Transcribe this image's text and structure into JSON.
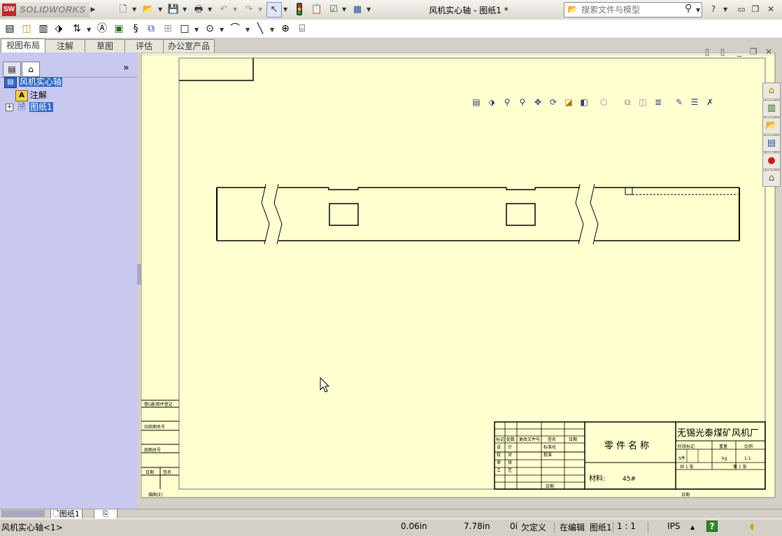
{
  "app": {
    "name": "SOLIDWORKS",
    "logo_mark": "SW",
    "document_title": "风机实心轴 - 图纸1 *"
  },
  "search": {
    "placeholder": "搜索文件与模型"
  },
  "title_controls": {
    "help": "?",
    "minimize": "▭",
    "restore": "❐",
    "close": "✕"
  },
  "command_tabs": [
    {
      "label": "视图布局",
      "active": true
    },
    {
      "label": "注解",
      "active": false
    },
    {
      "label": "草图",
      "active": false
    },
    {
      "label": "评估",
      "active": false
    },
    {
      "label": "办公室产品",
      "active": false
    }
  ],
  "feature_tree": {
    "root": "风机实心轴",
    "items": [
      {
        "label": "注解",
        "icon": "annotation-icon"
      },
      {
        "label": "图纸1",
        "icon": "sheet-icon",
        "expander": "+"
      }
    ],
    "collapse_label": "»"
  },
  "title_block": {
    "part_name": "零件名称",
    "material_label": "材料:",
    "material_value": "45#",
    "company": "无锡光泰煤矿风机厂",
    "header_row": [
      "标记",
      "处数",
      "更改文件号",
      "签名",
      "日期"
    ],
    "left_rows": [
      [
        "设",
        "计"
      ],
      [
        "校",
        "对"
      ],
      [
        "审",
        "核"
      ],
      [
        "工",
        "艺"
      ]
    ],
    "mid_rows": [
      "标准化",
      "批准",
      "日期"
    ],
    "right_header": [
      "阶段标记",
      "重量",
      "比例"
    ],
    "right_values": [
      "S件",
      "kg",
      "1:1"
    ],
    "sheet_info": [
      "共 1 张",
      "第 1 张"
    ],
    "date_label": "日期"
  },
  "left_strip": {
    "labels": [
      "借(通)用件登记",
      "旧底图总号",
      "底图总号",
      "日期",
      "签名",
      "描图(E)"
    ]
  },
  "status": {
    "left": "风机实心轴<1>",
    "x": "0.06in",
    "y": "7.78in",
    "z": "0i",
    "definition": "欠定义",
    "mode": "在编辑",
    "sheet": "图纸1",
    "scale": "1 : 1",
    "units": "IPS",
    "help": "?"
  },
  "sheet_tab": {
    "label": "图纸1"
  }
}
